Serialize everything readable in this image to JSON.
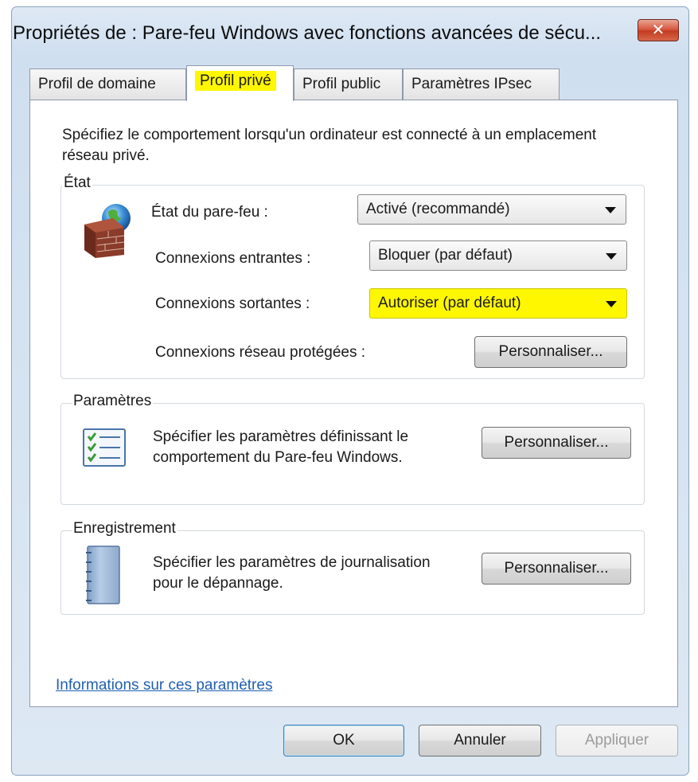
{
  "window": {
    "title": "Propriétés de : Pare-feu Windows avec fonctions avancées de sécu...",
    "close_label": "✕"
  },
  "tabs": [
    {
      "label": "Profil de domaine",
      "active": false
    },
    {
      "label": "Profil privé",
      "active": true
    },
    {
      "label": "Profil public",
      "active": false
    },
    {
      "label": "Paramètres IPsec",
      "active": false
    }
  ],
  "intro": "Spécifiez le comportement lorsqu'un ordinateur est connecté à un emplacement réseau privé.",
  "etat": {
    "group_label": "État",
    "firewall_state": {
      "label": "État du pare-feu :",
      "value": "Activé (recommandé)"
    },
    "inbound": {
      "label": "Connexions entrantes :",
      "value": "Bloquer (par défaut)"
    },
    "outbound": {
      "label": "Connexions sortantes :",
      "value": "Autoriser (par défaut)"
    },
    "protected": {
      "label": "Connexions réseau protégées :",
      "button": "Personnaliser..."
    }
  },
  "parametres": {
    "group_label": "Paramètres",
    "text": "Spécifier les paramètres définissant le comportement du Pare-feu Windows.",
    "button": "Personnaliser..."
  },
  "enregistrement": {
    "group_label": "Enregistrement",
    "text": "Spécifier les paramètres de journalisation pour le dépannage.",
    "button": "Personnaliser..."
  },
  "link": "Informations sur ces paramètres",
  "footer": {
    "ok": "OK",
    "cancel": "Annuler",
    "apply": "Appliquer"
  },
  "colors": {
    "highlight": "#fff700",
    "link": "#1f5fb0",
    "close_button": "#c23b20"
  },
  "icons": {
    "firewall": "firewall-globe-icon",
    "settings": "checklist-icon",
    "logging": "notebook-icon"
  }
}
